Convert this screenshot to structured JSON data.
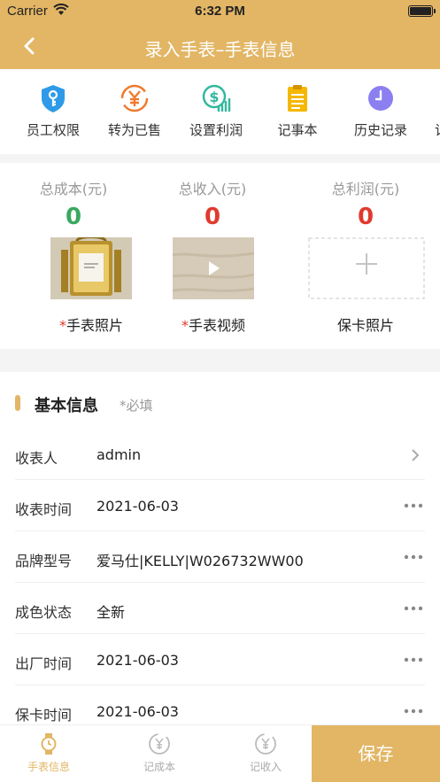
{
  "status": {
    "carrier": "Carrier",
    "time": "6:32 PM"
  },
  "nav": {
    "title": "录入手表–手表信息"
  },
  "tools": [
    {
      "label": "员工权限",
      "icon": "key-shield-icon"
    },
    {
      "label": "转为已售",
      "icon": "yen-exchange-icon"
    },
    {
      "label": "设置利润",
      "icon": "dollar-chart-icon"
    },
    {
      "label": "记事本",
      "icon": "notepad-icon"
    },
    {
      "label": "历史记录",
      "icon": "clock-icon"
    },
    {
      "label": "记",
      "icon": "partial-tool-icon"
    }
  ],
  "totals": {
    "cost": {
      "caption": "总成本(元)",
      "value": "0",
      "color": "#3aa860"
    },
    "income": {
      "caption": "总收入(元)",
      "value": "0",
      "color": "#e03a2e"
    },
    "profit": {
      "caption": "总利润(元)",
      "value": "0",
      "color": "#e03a2e"
    }
  },
  "media": {
    "watch_photo": {
      "req": "*",
      "label": "手表照片"
    },
    "watch_video": {
      "req": "*",
      "label": "手表视频"
    },
    "warranty_photo": {
      "label": "保卡照片"
    }
  },
  "basic": {
    "title": "基本信息",
    "hint": "*必填",
    "rows": [
      {
        "key": "收表人",
        "value": "admin"
      },
      {
        "key": "收表时间",
        "value": "2021-06-03"
      },
      {
        "key": "品牌型号",
        "value": "爱马仕|KELLY|W026732WW00"
      },
      {
        "key": "成色状态",
        "value": "全新"
      },
      {
        "key": "出厂时间",
        "value": "2021-06-03"
      },
      {
        "key": "保卡时间",
        "value": "2021-06-03"
      }
    ]
  },
  "tabbar": {
    "tabs": [
      {
        "label": "手表信息",
        "active": true
      },
      {
        "label": "记成本",
        "active": false
      },
      {
        "label": "记收入",
        "active": false
      }
    ],
    "save": "保存"
  },
  "colors": {
    "accent": "#e2b665",
    "green": "#3aa860",
    "red": "#e03a2e"
  }
}
